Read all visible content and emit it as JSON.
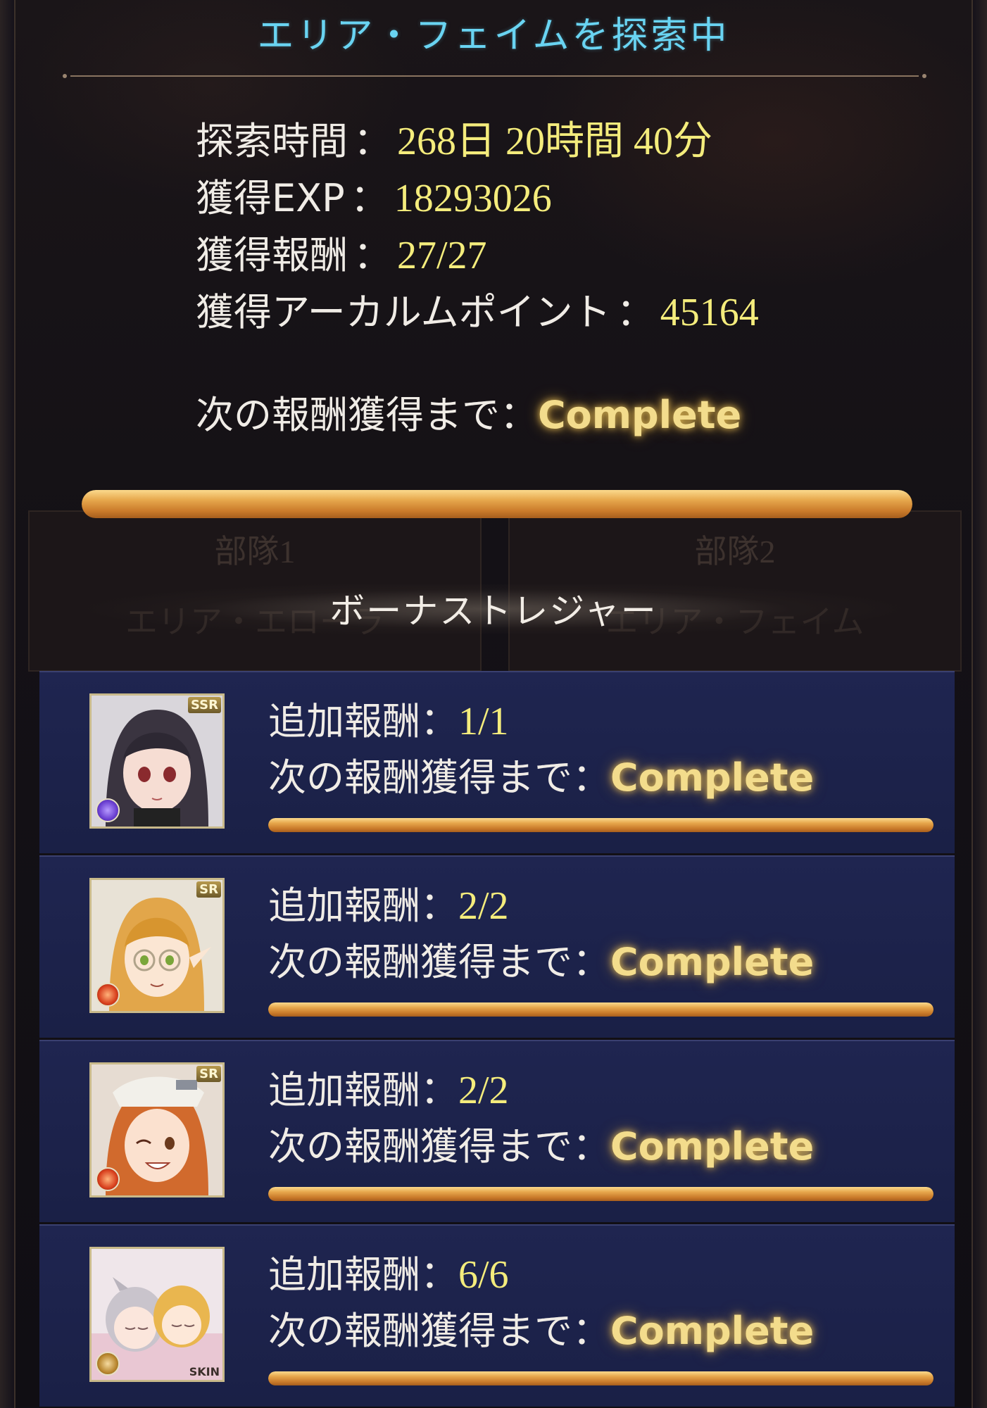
{
  "header": {
    "title": "エリア・フェイムを探索中"
  },
  "stats": {
    "time_label": "探索時間",
    "time_value": "268日 20時間 40分",
    "exp_label": "獲得EXP",
    "exp_value": "18293026",
    "reward_label": "獲得報酬",
    "reward_value": "27/27",
    "arcarum_label": "獲得アーカルムポイント",
    "arcarum_value": "45164",
    "separator": "："
  },
  "next_reward": {
    "label": "次の報酬獲得まで：",
    "value": "Complete",
    "progress": 1.0
  },
  "background_squads": {
    "squad1_name": "部隊1",
    "squad1_area": "エリア・エローラ",
    "squad2_name": "部隊2",
    "squad2_area": "エリア・フェイム"
  },
  "bonus": {
    "title": "ボーナストレジャー",
    "rows": [
      {
        "extra_label": "追加報酬：",
        "extra_value": "1/1",
        "next_label": "次の報酬獲得まで：",
        "next_value": "Complete",
        "rarity": "SSR",
        "element_color": "#6a3fd1",
        "progress": 1.0
      },
      {
        "extra_label": "追加報酬：",
        "extra_value": "2/2",
        "next_label": "次の報酬獲得まで：",
        "next_value": "Complete",
        "rarity": "SR",
        "element_color": "#d8401e",
        "progress": 1.0
      },
      {
        "extra_label": "追加報酬：",
        "extra_value": "2/2",
        "next_label": "次の報酬獲得まで：",
        "next_value": "Complete",
        "rarity": "SR",
        "element_color": "#d8401e",
        "progress": 1.0
      },
      {
        "extra_label": "追加報酬：",
        "extra_value": "6/6",
        "next_label": "次の報酬獲得まで：",
        "next_value": "Complete",
        "rarity": "SKIN",
        "element_color": "#b8862e",
        "progress": 1.0
      }
    ]
  },
  "colors": {
    "header_text": "#69d4f2",
    "value_text": "#f4ec7c",
    "complete_glow": "#f3dc8c",
    "row_background": "#1f2550",
    "progress_fill": "#e7a84d"
  }
}
